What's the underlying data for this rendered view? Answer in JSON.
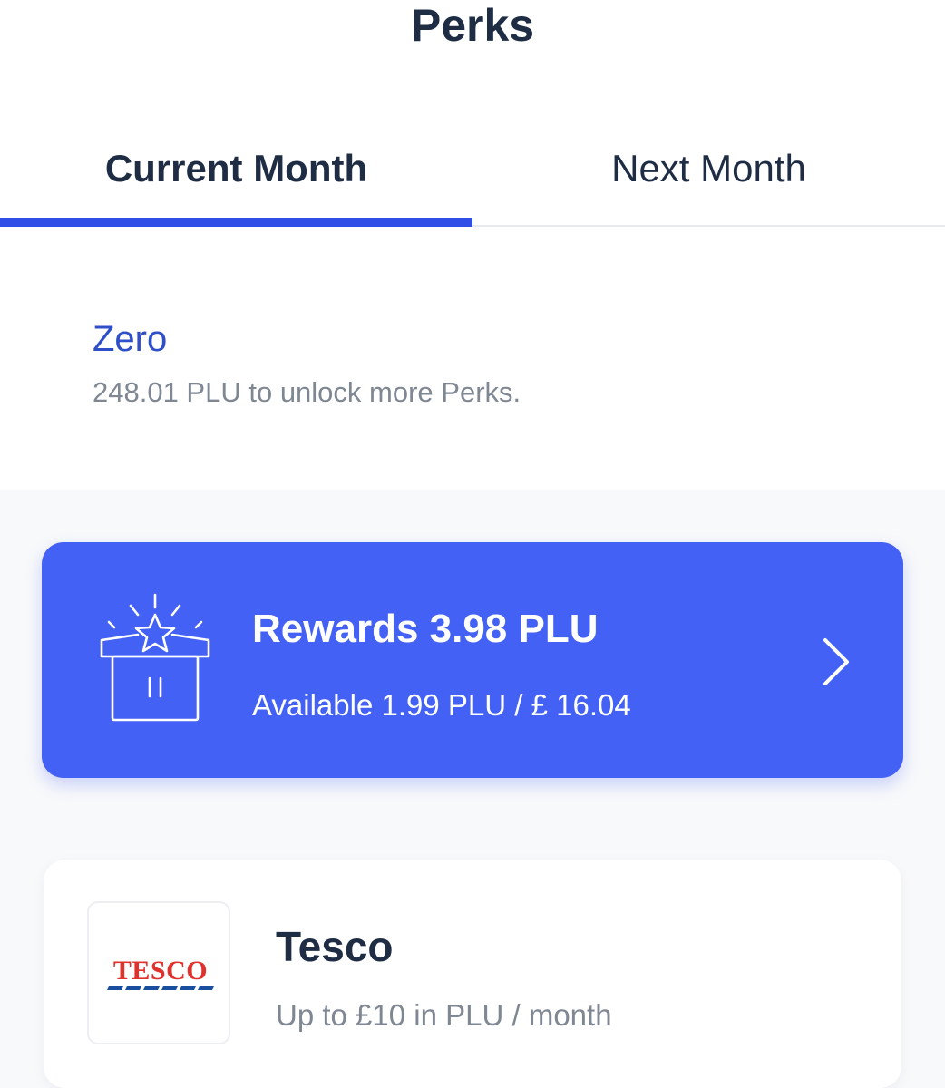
{
  "header": {
    "title": "Perks"
  },
  "tabs": [
    {
      "label": "Current Month",
      "selected": true
    },
    {
      "label": "Next Month",
      "selected": false
    }
  ],
  "level": {
    "name": "Zero",
    "unlock_text": "248.01 PLU to unlock more Perks."
  },
  "rewards": {
    "title": "Rewards 3.98 PLU",
    "available": "Available 1.99 PLU / £ 16.04",
    "icon": "gift-star-icon",
    "chevron": "chevron-right-icon"
  },
  "perks": [
    {
      "name": "Tesco",
      "description": "Up to £10 in PLU / month",
      "logo_text": "TESCO"
    }
  ],
  "colors": {
    "accent": "#2f4fe6",
    "card_blue": "#4361f5",
    "title_dark": "#1f2d44",
    "muted_text": "#7f8793",
    "level_blue": "#2f4fc8",
    "tesco_red": "#e0312d",
    "tesco_blue": "#1a4fa0"
  }
}
